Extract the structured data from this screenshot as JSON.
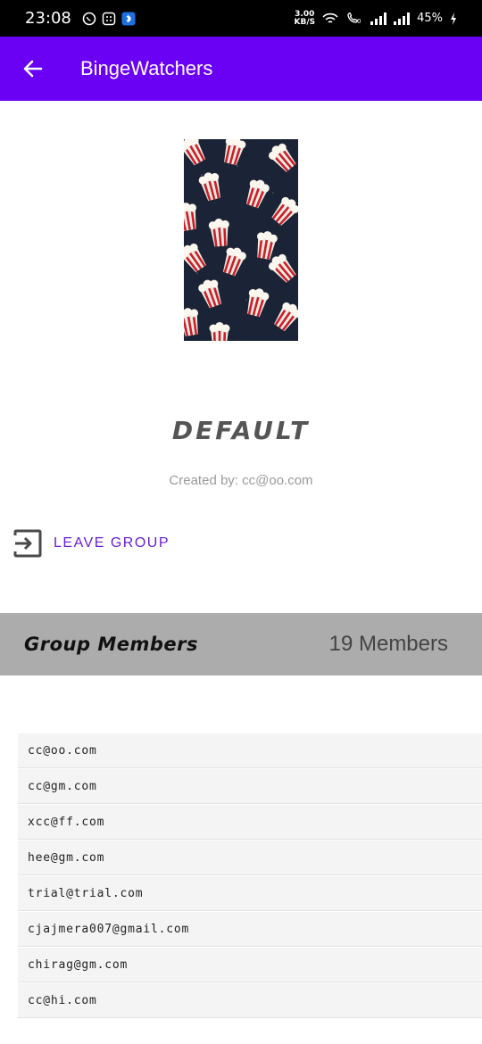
{
  "status_bar": {
    "time": "23:08",
    "net_speed_value": "3.00",
    "net_speed_unit": "KB/S",
    "battery": "45%"
  },
  "app_bar": {
    "title": "BingeWatchers",
    "accent_color": "#6a00f4"
  },
  "group": {
    "name": "DEFAULT",
    "created_by": "Created by: cc@oo.com"
  },
  "actions": {
    "leave_label": "LEAVE GROUP"
  },
  "members": {
    "heading": "Group Members",
    "count_label": "19 Members",
    "items": [
      "cc@oo.com",
      "cc@gm.com",
      "xcc@ff.com",
      "hee@gm.com",
      "trial@trial.com",
      "cjajmera007@gmail.com",
      "chirag@gm.com",
      "cc@hi.com"
    ]
  },
  "icons": {
    "back": "arrow-left-icon",
    "leave": "exit-icon",
    "poster": "popcorn-pattern"
  }
}
